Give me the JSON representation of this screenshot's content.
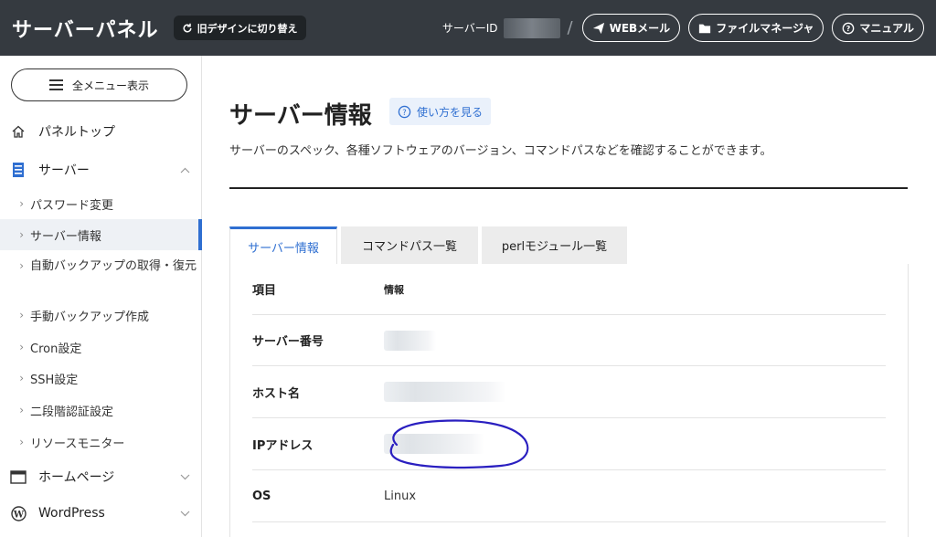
{
  "header": {
    "title": "サーバーパネル",
    "old_design_label": "旧デザインに切り替え",
    "server_id_label": "サーバーID",
    "slash": "/",
    "webmail_label": "WEBメール",
    "filemanager_label": "ファイルマネージャ",
    "manual_label": "マニュアル"
  },
  "sidebar": {
    "all_menu_label": "全メニュー表示",
    "panel_top": "パネルトップ",
    "server": "サーバー",
    "sub_items": [
      {
        "label": "パスワード変更"
      },
      {
        "label": "サーバー情報"
      },
      {
        "label": "自動バックアップの取得・復元"
      },
      {
        "label": "手動バックアップ作成"
      },
      {
        "label": "Cron設定"
      },
      {
        "label": "SSH設定"
      },
      {
        "label": "二段階認証設定"
      },
      {
        "label": "リソースモニター"
      }
    ],
    "homepage": "ホームページ",
    "wordpress": "WordPress"
  },
  "main": {
    "title": "サーバー情報",
    "howto_label": "使い方を見る",
    "description": "サーバーのスペック、各種ソフトウェアのバージョン、コマンドパスなどを確認することができます。",
    "tabs": [
      {
        "label": "サーバー情報"
      },
      {
        "label": "コマンドパス一覧"
      },
      {
        "label": "perlモジュール一覧"
      }
    ],
    "table": {
      "headers": [
        "項目",
        "情報"
      ],
      "rows": [
        {
          "key": "サーバー番号",
          "value": ""
        },
        {
          "key": "ホスト名",
          "value": ""
        },
        {
          "key": "IPアドレス",
          "value": ""
        },
        {
          "key": "OS",
          "value": "Linux"
        }
      ]
    }
  },
  "colors": {
    "header_bg": "#353a40",
    "accent": "#2f6fd1",
    "annotation": "#2a1fc0"
  }
}
